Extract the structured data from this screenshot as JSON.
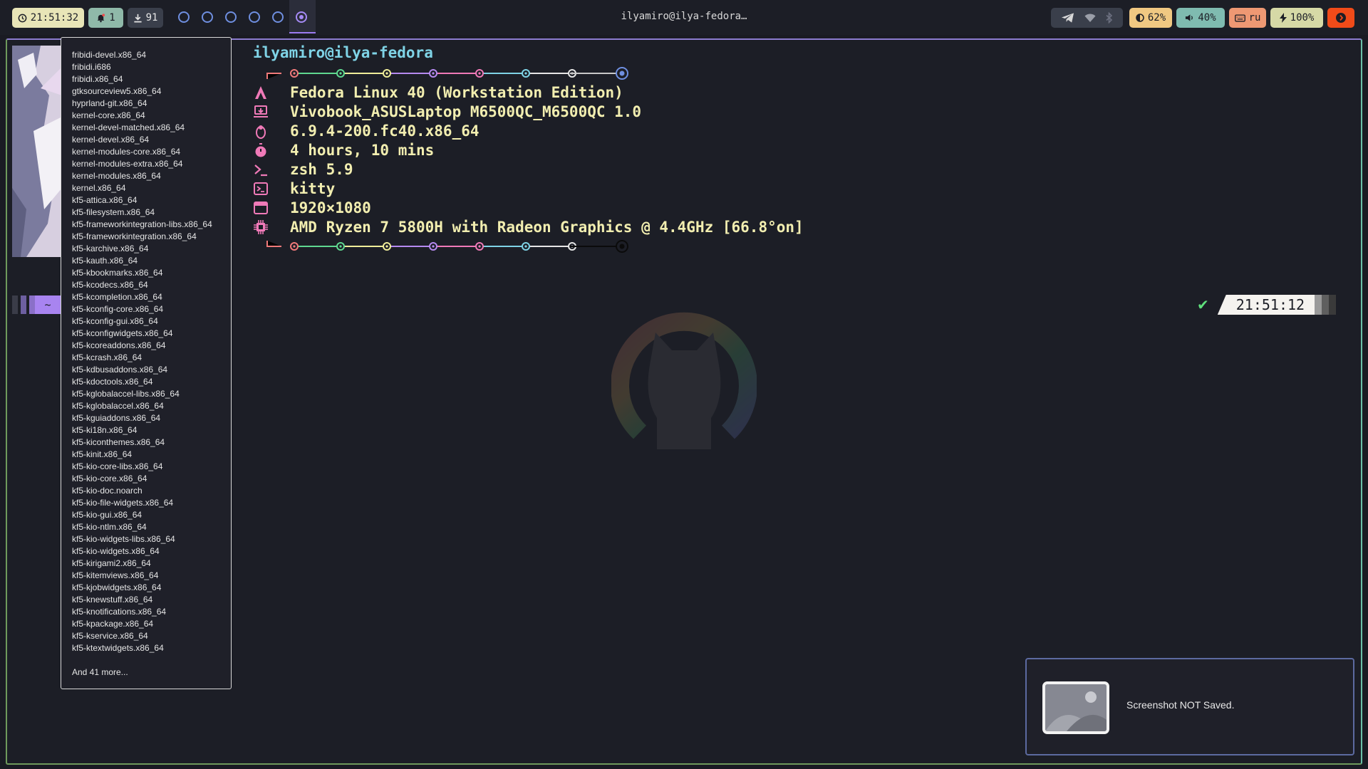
{
  "topbar": {
    "clock": "21:51:32",
    "notifications": "1",
    "updates": "91",
    "workspaces": [
      "1",
      "2",
      "3",
      "4",
      "5",
      "6"
    ],
    "window_title": "ilyamiro@ilya-fedora…",
    "brightness": "62%",
    "volume": "40%",
    "keyboard_layout": "ru",
    "battery": "100%",
    "icons": {
      "clock": "clock-icon",
      "bell": "bell-icon",
      "download": "download-icon",
      "telegram": "telegram-icon",
      "wifi": "wifi-icon",
      "bluetooth": "bluetooth-icon",
      "brightness": "brightness-icon",
      "volume": "speaker-icon",
      "keyboard": "keyboard-icon",
      "battery": "bolt-icon",
      "power": "power-icon"
    },
    "colors": {
      "active_workspace": "#a58af5",
      "power_button": "#f04b19"
    }
  },
  "tooltip": {
    "packages": [
      "fribidi-devel.x86_64",
      "fribidi.i686",
      "fribidi.x86_64",
      "gtksourceview5.x86_64",
      "hyprland-git.x86_64",
      "kernel-core.x86_64",
      "kernel-devel-matched.x86_64",
      "kernel-devel.x86_64",
      "kernel-modules-core.x86_64",
      "kernel-modules-extra.x86_64",
      "kernel-modules.x86_64",
      "kernel.x86_64",
      "kf5-attica.x86_64",
      "kf5-filesystem.x86_64",
      "kf5-frameworkintegration-libs.x86_64",
      "kf5-frameworkintegration.x86_64",
      "kf5-karchive.x86_64",
      "kf5-kauth.x86_64",
      "kf5-kbookmarks.x86_64",
      "kf5-kcodecs.x86_64",
      "kf5-kcompletion.x86_64",
      "kf5-kconfig-core.x86_64",
      "kf5-kconfig-gui.x86_64",
      "kf5-kconfigwidgets.x86_64",
      "kf5-kcoreaddons.x86_64",
      "kf5-kcrash.x86_64",
      "kf5-kdbusaddons.x86_64",
      "kf5-kdoctools.x86_64",
      "kf5-kglobalaccel-libs.x86_64",
      "kf5-kglobalaccel.x86_64",
      "kf5-kguiaddons.x86_64",
      "kf5-ki18n.x86_64",
      "kf5-kiconthemes.x86_64",
      "kf5-kinit.x86_64",
      "kf5-kio-core-libs.x86_64",
      "kf5-kio-core.x86_64",
      "kf5-kio-doc.noarch",
      "kf5-kio-file-widgets.x86_64",
      "kf5-kio-gui.x86_64",
      "kf5-kio-ntlm.x86_64",
      "kf5-kio-widgets-libs.x86_64",
      "kf5-kio-widgets.x86_64",
      "kf5-kirigami2.x86_64",
      "kf5-kitemviews.x86_64",
      "kf5-kjobwidgets.x86_64",
      "kf5-knewstuff.x86_64",
      "kf5-knotifications.x86_64",
      "kf5-kpackage.x86_64",
      "kf5-kservice.x86_64",
      "kf5-ktextwidgets.x86_64"
    ],
    "more": "And 41 more..."
  },
  "terminal": {
    "user_host": "ilyamiro@ilya-fedora",
    "fetch": [
      {
        "icon": "fedora-icon",
        "color": "#f07ab8",
        "value": "Fedora Linux 40 (Workstation Edition)"
      },
      {
        "icon": "laptop-icon",
        "color": "#f07ab8",
        "value": "Vivobook_ASUSLaptop M6500QC_M6500QC 1.0"
      },
      {
        "icon": "penguin-icon",
        "color": "#f07ab8",
        "value": "6.9.4-200.fc40.x86_64"
      },
      {
        "icon": "stopwatch-icon",
        "color": "#f07ab8",
        "value": "4 hours, 10 mins"
      },
      {
        "icon": "shell-prompt-icon",
        "color": "#f07ab8",
        "value": "zsh 5.9"
      },
      {
        "icon": "terminal-icon",
        "color": "#f07ab8",
        "value": "kitty"
      },
      {
        "icon": "monitor-icon",
        "color": "#f07ab8",
        "value": "1920×1080"
      },
      {
        "icon": "cpu-icon",
        "color": "#f07ab8",
        "value": "AMD Ryzen 7 5800H with Radeon Graphics @ 4.4GHz [66.8°on]"
      }
    ],
    "prompt_dir": "~",
    "prompt_time": "21:51:12",
    "dot_colors": [
      "#f07a7a",
      "#5fd890",
      "#f0ee9a",
      "#b68af0",
      "#f07ab8",
      "#7fd3e6",
      "#e6e6e6"
    ]
  },
  "notification": {
    "message": "Screenshot NOT Saved.",
    "icon": "image-icon"
  }
}
